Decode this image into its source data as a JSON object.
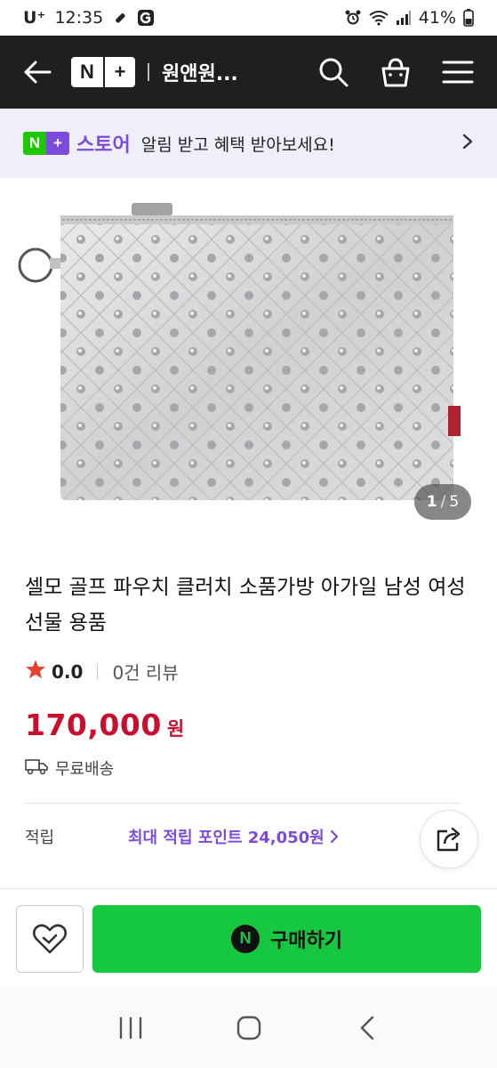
{
  "status_bar": {
    "carrier": "U⁺",
    "time": "12:35",
    "battery": "41%"
  },
  "header": {
    "logo_n": "N",
    "logo_plus": "+",
    "store_name": "원앤원..."
  },
  "promo": {
    "logo_n": "N",
    "logo_plus": "+",
    "store_label": "스토어",
    "text": "알림 받고 혜택 받아보세요!"
  },
  "gallery": {
    "current": "1",
    "separator": "/",
    "total": "5"
  },
  "product": {
    "title": "셀모 골프 파우치 클러치 소품가방 아가일 남성 여성 선물 용품",
    "rating_score": "0.0",
    "review_count": "0건 리뷰",
    "price": "170,000",
    "price_unit": "원",
    "shipping": "무료배송",
    "points_label": "적립",
    "points_value": "최대 적립 포인트 24,050원"
  },
  "buy_bar": {
    "buy_badge": "N",
    "buy_label": "구매하기"
  },
  "colors": {
    "header_bg": "#1f1f1f",
    "accent_purple": "#7b4cdb",
    "naver_green": "#16c83f",
    "price_red": "#c8102e"
  }
}
